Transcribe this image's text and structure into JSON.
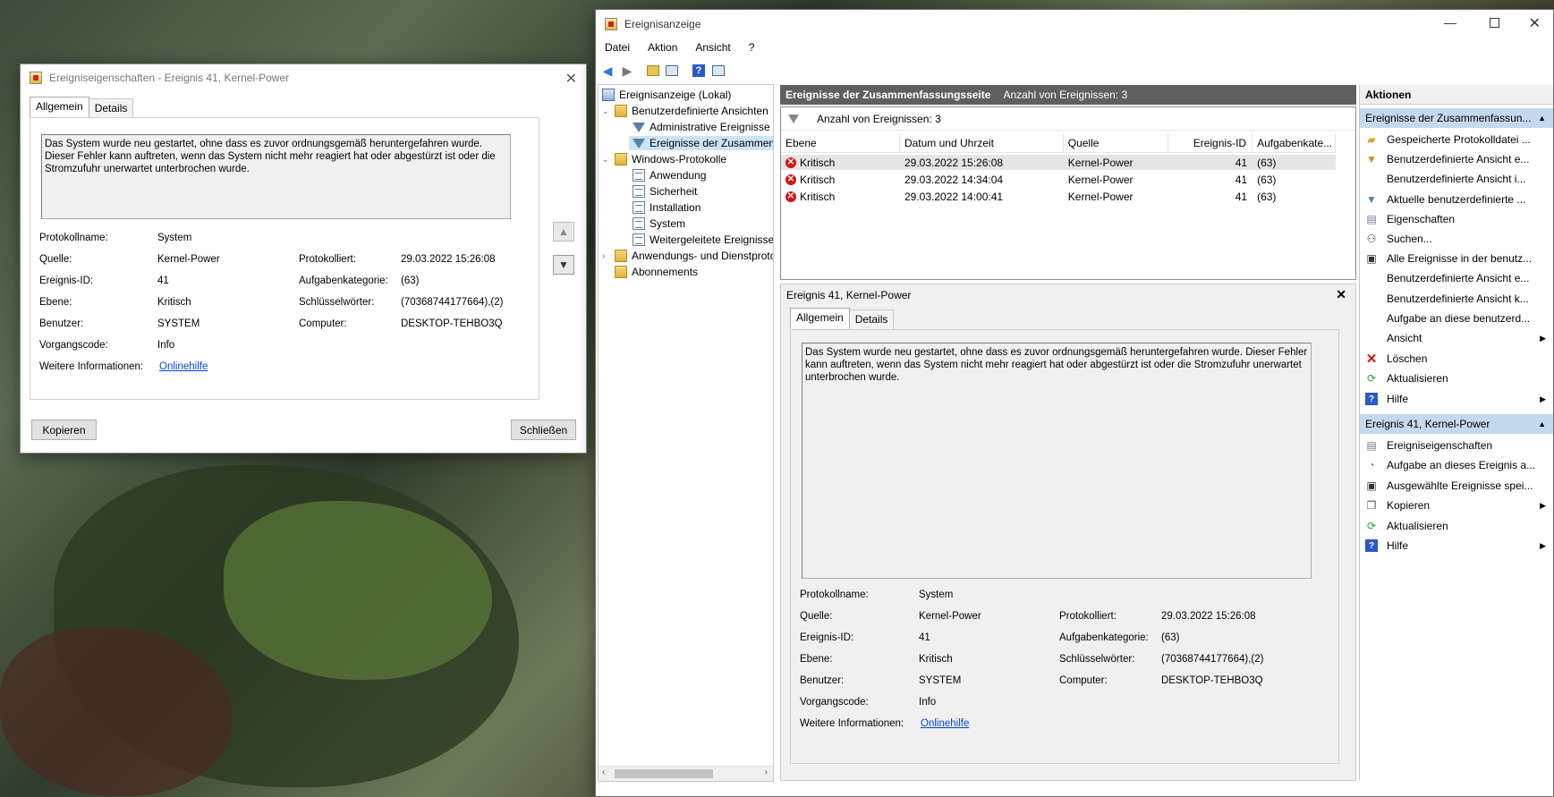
{
  "dialog": {
    "title": "Ereigniseigenschaften - Ereignis 41, Kernel-Power",
    "tabs": [
      "Allgemein",
      "Details"
    ],
    "description": "Das System wurde neu gestartet, ohne dass es zuvor ordnungsgemäß heruntergefahren wurde. Dieser Fehler kann auftreten, wenn das System nicht mehr reagiert hat oder abgestürzt ist oder die Stromzufuhr unerwartet unterbrochen wurde.",
    "props": {
      "protokollname_label": "Protokollname:",
      "protokollname": "System",
      "quelle_label": "Quelle:",
      "quelle": "Kernel-Power",
      "protokolliert_label": "Protokolliert:",
      "protokolliert": "29.03.2022 15:26:08",
      "ereignis_id_label": "Ereignis-ID:",
      "ereignis_id": "41",
      "aufgabenkategorie_label": "Aufgabenkategorie:",
      "aufgabenkategorie": "(63)",
      "ebene_label": "Ebene:",
      "ebene": "Kritisch",
      "schluesselwoerter_label": "Schlüsselwörter:",
      "schluesselwoerter": "(70368744177664),(2)",
      "benutzer_label": "Benutzer:",
      "benutzer": "SYSTEM",
      "computer_label": "Computer:",
      "computer": "DESKTOP-TEHBO3Q",
      "vorgangscode_label": "Vorgangscode:",
      "vorgangscode": "Info",
      "weitere_label": "Weitere Informationen:",
      "weitere_link": "Onlinehilfe"
    },
    "copy_button": "Kopieren",
    "close_button": "Schließen"
  },
  "main": {
    "title": "Ereignisanzeige",
    "menu": [
      "Datei",
      "Aktion",
      "Ansicht",
      "?"
    ],
    "tree": [
      "Ereignisanzeige (Lokal)",
      "Benutzerdefinierte Ansichten",
      "Administrative Ereignisse",
      "Ereignisse der Zusammenfassungsseite",
      "Windows-Protokolle",
      "Anwendung",
      "Sicherheit",
      "Installation",
      "System",
      "Weitergeleitete Ereignisse",
      "Anwendungs- und Dienstprotokolle",
      "Abonnements"
    ],
    "center_header": "Ereignisse der Zusammenfassungsseite",
    "center_count": "Anzahl von Ereignissen: 3",
    "filter_count": "Anzahl von Ereignissen: 3",
    "columns": [
      "Ebene",
      "Datum und Uhrzeit",
      "Quelle",
      "Ereignis-ID",
      "Aufgabenkate..."
    ],
    "rows": [
      {
        "level": "Kritisch",
        "date": "29.03.2022 15:26:08",
        "source": "Kernel-Power",
        "id": "41",
        "task": "(63)"
      },
      {
        "level": "Kritisch",
        "date": "29.03.2022 14:34:04",
        "source": "Kernel-Power",
        "id": "41",
        "task": "(63)"
      },
      {
        "level": "Kritisch",
        "date": "29.03.2022 14:00:41",
        "source": "Kernel-Power",
        "id": "41",
        "task": "(63)"
      }
    ],
    "detail_title": "Ereignis 41, Kernel-Power",
    "detail_tabs": [
      "Allgemein",
      "Details"
    ],
    "actions_header": "Aktionen",
    "actions_section1": "Ereignisse der Zusammenfassun...",
    "actions1": [
      "Gespeicherte Protokolldatei ...",
      "Benutzerdefinierte Ansicht e...",
      "Benutzerdefinierte Ansicht i...",
      "Aktuelle benutzerdefinierte ...",
      "Eigenschaften",
      "Suchen...",
      "Alle Ereignisse in der benutz...",
      "Benutzerdefinierte Ansicht e...",
      "Benutzerdefinierte Ansicht k...",
      "Aufgabe an diese benutzerd...",
      "Ansicht",
      "Löschen",
      "Aktualisieren",
      "Hilfe"
    ],
    "actions_section2": "Ereignis 41, Kernel-Power",
    "actions2": [
      "Ereigniseigenschaften",
      "Aufgabe an dieses Ereignis a...",
      "Ausgewählte Ereignisse spei...",
      "Kopieren",
      "Aktualisieren",
      "Hilfe"
    ]
  },
  "colors": {
    "critical": "#d11111",
    "link": "#0047d6",
    "header_dark": "#5f5f5f",
    "action_section": "#c4d8ee"
  }
}
